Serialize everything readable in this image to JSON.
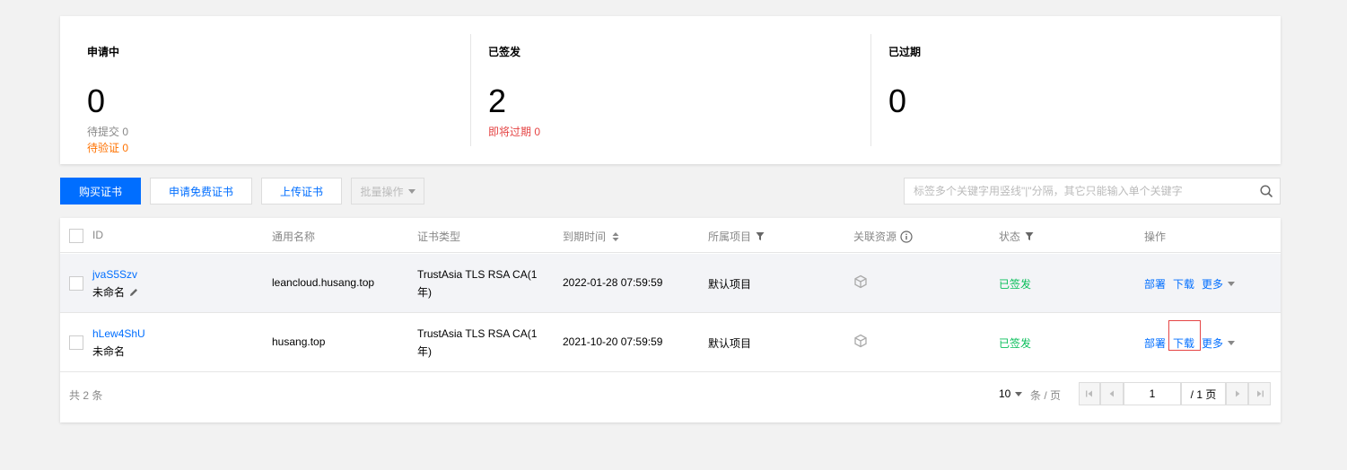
{
  "stats": [
    {
      "title": "申请中",
      "value": "0",
      "sub1": "待提交 0",
      "sub2": "待验证 0"
    },
    {
      "title": "已签发",
      "value": "2",
      "sub1": "即将过期 0"
    },
    {
      "title": "已过期",
      "value": "0"
    }
  ],
  "toolbar": {
    "buy_label": "购买证书",
    "apply_free_label": "申请免费证书",
    "upload_label": "上传证书",
    "batch_label": "批量操作",
    "search_placeholder": "标签多个关键字用竖线\"|\"分隔，其它只能输入单个关键字"
  },
  "table": {
    "headers": {
      "id": "ID",
      "name": "通用名称",
      "type": "证书类型",
      "expiry": "到期时间",
      "project": "所属项目",
      "resource": "关联资源",
      "status": "状态",
      "actions": "操作"
    },
    "rows": [
      {
        "id": "jvaS5Szv",
        "alias": "未命名",
        "domain": "leancloud.husang.top",
        "type_line1": "TrustAsia TLS RSA CA(1",
        "type_line2": "年)",
        "expiry": "2022-01-28 07:59:59",
        "project": "默认项目",
        "status": "已签发",
        "deploy": "部署",
        "download": "下载",
        "more": "更多"
      },
      {
        "id": "hLew4ShU",
        "alias": "未命名",
        "domain": "husang.top",
        "type_line1": "TrustAsia TLS RSA CA(1",
        "type_line2": "年)",
        "expiry": "2021-10-20 07:59:59",
        "project": "默认项目",
        "status": "已签发",
        "deploy": "部署",
        "download": "下载",
        "more": "更多"
      }
    ]
  },
  "footer": {
    "total": "共 2 条",
    "page_size": "10",
    "per_page_unit": "条 / 页",
    "page_input": "1",
    "page_total": "/ 1 页"
  },
  "colors": {
    "accent": "#006eff",
    "success": "#0abf5b",
    "warning": "#ff7200",
    "danger": "#e54545"
  }
}
